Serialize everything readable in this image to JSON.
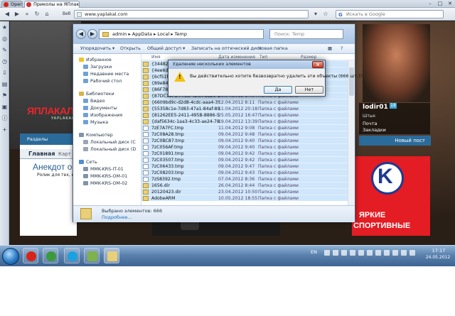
{
  "browser": {
    "tabs": [
      {
        "label": "Opera",
        "active": false
      },
      {
        "label": "Приколы на ЯПлакалъ",
        "active": true
      }
    ],
    "web_label": "Веб",
    "url": "www.yaplakal.com",
    "search_placeholder": "Искать в Google",
    "search_brand": "G"
  },
  "site": {
    "logo": "ЯПЛАКАЛ",
    "logo_sub": "YAPLAKAL",
    "section_label": "Разделы",
    "tab_main": "Главная",
    "tab_other": "Карт",
    "headline": "Анекдот о",
    "subline": "Ролик для тех, к",
    "username": "lodir01",
    "user_badge": "18",
    "user_role": "Штык",
    "mail_label": "Почта",
    "bookmarks_label": "Закладки",
    "new_post_label": "Новый пост",
    "ad_brand": "K",
    "ad_line1": "ЯРКИЕ",
    "ad_line2": "СПОРТИВНЫЕ",
    "accent_color": "#2b6b9a",
    "ad_color": "#e41c23"
  },
  "explorer": {
    "path": [
      "admin",
      "AppData",
      "Local",
      "Temp"
    ],
    "search_placeholder": "Поиск: Temp",
    "toolbar": [
      "Упорядочить ▾",
      "Открыть",
      "Общий доступ ▾",
      "Записать на оптический диск",
      "Новая папка"
    ],
    "columns": [
      "Имя",
      "Дата изменения",
      "Тип",
      "Размер"
    ],
    "nav": [
      {
        "label": "Избранное",
        "sub": false
      },
      {
        "label": "Загрузки",
        "sub": true
      },
      {
        "label": "Недавние места",
        "sub": true
      },
      {
        "label": "Рабочий стол",
        "sub": true
      },
      {
        "label": "Библиотеки",
        "sub": false
      },
      {
        "label": "Видео",
        "sub": true
      },
      {
        "label": "Документы",
        "sub": true
      },
      {
        "label": "Изображения",
        "sub": true
      },
      {
        "label": "Музыка",
        "sub": true
      },
      {
        "label": "Компьютер",
        "sub": false
      },
      {
        "label": "Локальный диск (C",
        "sub": true
      },
      {
        "label": "Локальный диск (D",
        "sub": true
      },
      {
        "label": "Сеть",
        "sub": false
      },
      {
        "label": "MMK-KRS-IT-01",
        "sub": true
      },
      {
        "label": "MMK-KRS-OM-01",
        "sub": true
      },
      {
        "label": "MMK-KRS-OM-02",
        "sub": true
      }
    ],
    "files": [
      {
        "name": "{344827E9-B6E8",
        "date": "",
        "type": "",
        "kind": "folder"
      },
      {
        "name": "{4ee6d0c9-cb47",
        "date": "",
        "type": "",
        "kind": "folder"
      },
      {
        "name": "{6cf51f78-5f3d-",
        "date": "",
        "type": "",
        "kind": "folder"
      },
      {
        "name": "{89e8471 3-daf1",
        "date": "",
        "type": "",
        "kind": "folder"
      },
      {
        "name": "{86F78A0A-4CA",
        "date": "",
        "type": "",
        "kind": "folder"
      },
      {
        "name": "{87DC1EFC-F738-420A-8826-5868C4479A...",
        "date": "29.04.2012 14:54",
        "type": "Папка с файлами",
        "kind": "folder"
      },
      {
        "name": "{6609bd9c-d2d8-4cdc-aaa4-3541d13530fa}",
        "date": "12.04.2012 8:11",
        "type": "Папка с файлами",
        "kind": "folder"
      },
      {
        "name": "{55358c1e-7d83-47a1-84af-89ad85ad83f3}",
        "date": "11.04.2012 20:18",
        "type": "Папка с файлами",
        "kind": "folder"
      },
      {
        "name": "{81262EE5-2411-495B-8886-5A26F5E4C7E...",
        "date": "25.05.2012 16:47",
        "type": "Папка с файлами",
        "kind": "folder"
      },
      {
        "name": "{daf5634c-1aa3-4c33-ae24-786a370635d2}",
        "date": "19.04.2012 13:39",
        "type": "Папка с файлами",
        "kind": "folder"
      },
      {
        "name": "7zE7A7FC.tmp",
        "date": "11.04.2012 9:08",
        "type": "Папка с файлами",
        "kind": "file"
      },
      {
        "name": "7zC08A28.tmp",
        "date": "09.04.2012 9:48",
        "type": "Папка с файлами",
        "kind": "file"
      },
      {
        "name": "7zC0BC87.tmp",
        "date": "09.04.2012 9:40",
        "type": "Папка с файлами",
        "kind": "file"
      },
      {
        "name": "7zC056AF.tmp",
        "date": "09.04.2012 9:40",
        "type": "Папка с файлами",
        "kind": "file"
      },
      {
        "name": "7zC01891.tmp",
        "date": "09.04.2012 9:42",
        "type": "Папка с файлами",
        "kind": "file"
      },
      {
        "name": "7zC03507.tmp",
        "date": "09.04.2012 9:42",
        "type": "Папка с файлами",
        "kind": "file"
      },
      {
        "name": "7zC06433.tmp",
        "date": "09.04.2012 9:47",
        "type": "Папка с файлами",
        "kind": "file"
      },
      {
        "name": "7zC08203.tmp",
        "date": "09.04.2012 9:43",
        "type": "Папка с файлами",
        "kind": "file"
      },
      {
        "name": "7zS8392.tmp",
        "date": "07.04.2012 8:36",
        "type": "Папка с файлами",
        "kind": "file"
      },
      {
        "name": "1656.dir",
        "date": "26.04.2012 8:44",
        "type": "Папка с файлами",
        "kind": "folder"
      },
      {
        "name": "20120423.dir",
        "date": "23.04.2012 10:50",
        "type": "Папка с файлами",
        "kind": "folder"
      },
      {
        "name": "AdobeARM",
        "date": "10.05.2012 18:55",
        "type": "Папка с файлами",
        "kind": "folder"
      }
    ],
    "selected_count": "Выбрано элементов: 666",
    "more_label": "Подробнее..."
  },
  "dialog": {
    "title": "Удаление нескольких элементов",
    "message": "Вы действительно хотите безвозвратно удалить эти объекты (666 шт.)?",
    "yes": "Да",
    "no": "Нет",
    "close": "×"
  },
  "taskbar": {
    "language": "EN",
    "time": "17:17",
    "date": "24.05.2012"
  }
}
